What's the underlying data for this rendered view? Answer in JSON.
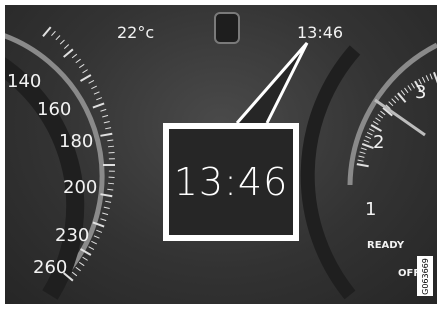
{
  "top_bar": {
    "temperature": "22°c",
    "clock": "13:46"
  },
  "callout": {
    "time": "13:46"
  },
  "speedometer": {
    "labels": [
      "140",
      "160",
      "180",
      "200",
      "230",
      "260"
    ]
  },
  "power_gauge": {
    "labels": [
      "3",
      "2",
      "1"
    ],
    "ready_label": "READY",
    "off_label": "OFF"
  },
  "figure_id": "G063669",
  "colors": {
    "panel_dark": "#333333",
    "label_light": "#f2f2f2",
    "callout_bg": "#262626",
    "callout_border": "#ffffff"
  }
}
